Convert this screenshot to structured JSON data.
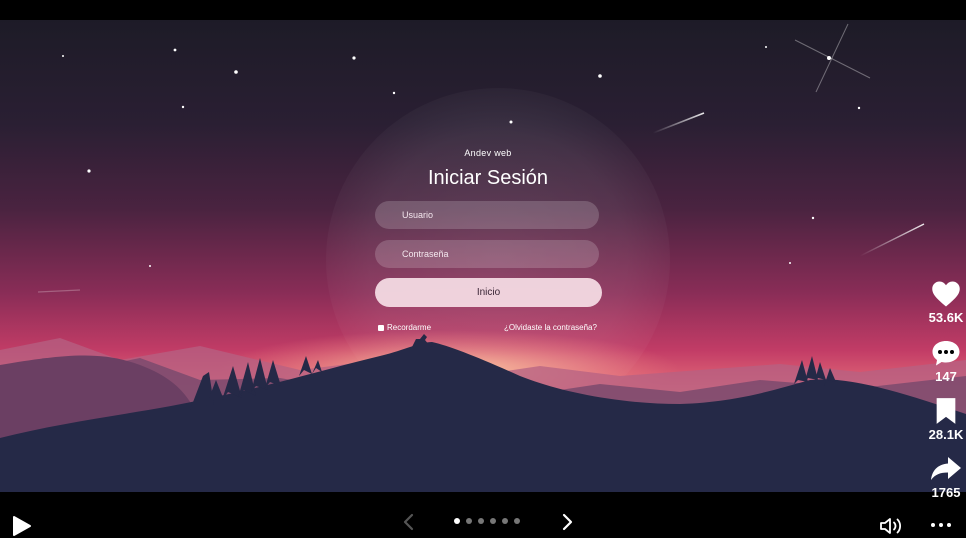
{
  "login": {
    "brand": "Andev web",
    "title": "Iniciar Sesión",
    "username_placeholder": "Usuario",
    "password_placeholder": "Contraseña",
    "submit_label": "Inicio",
    "remember_label": "Recordarme",
    "forgot_label": "¿Olvidaste la contraseña?"
  },
  "rail": {
    "likes": "53.6K",
    "comments": "147",
    "saves": "28.1K",
    "shares": "1765"
  },
  "player": {
    "carousel_total": 6,
    "carousel_active": 1
  },
  "icons": {
    "play": "play-icon",
    "prev": "chevron-left-icon",
    "next": "chevron-right-icon",
    "volume": "volume-icon",
    "more": "more-icon",
    "like": "heart-icon",
    "comment": "comment-icon",
    "save": "bookmark-icon",
    "share": "share-icon"
  },
  "colors": {
    "accent": "#f6dee6",
    "sky_top": "#1d1b27",
    "sky_glow": "#e36a78",
    "mountain": "#252947"
  }
}
